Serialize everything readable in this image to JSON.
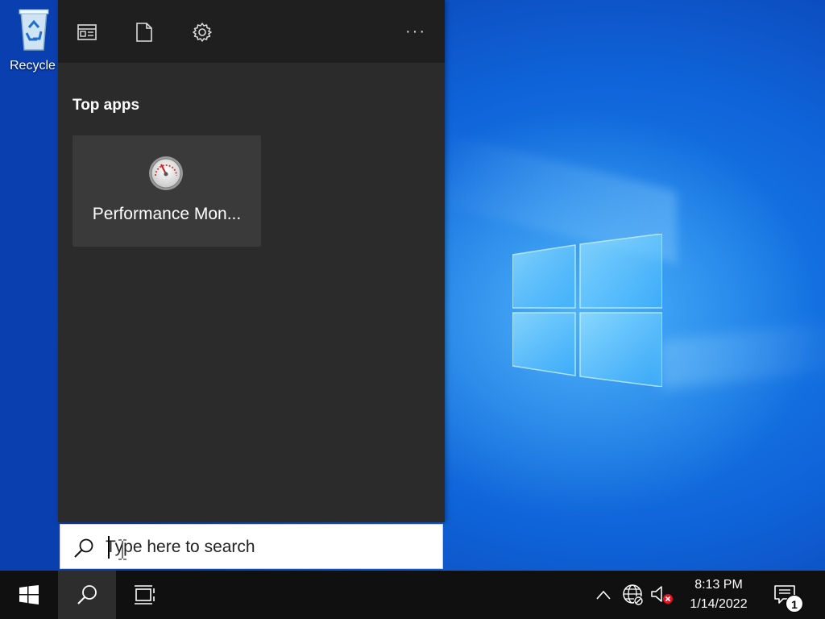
{
  "desktop": {
    "recycle_bin_label": "Recycle"
  },
  "search_panel": {
    "header_icons": [
      "app-tile-icon",
      "document-icon",
      "gear-icon"
    ],
    "more_label": "···",
    "top_apps_title": "Top apps",
    "top_apps": [
      {
        "name": "Performance Mon...",
        "icon": "performance-monitor-icon"
      }
    ]
  },
  "search_box": {
    "placeholder": "Type here to search",
    "value": ""
  },
  "taskbar": {
    "buttons": [
      "start-icon",
      "search-icon",
      "task-view-icon"
    ],
    "tray_icons": [
      "chevron-up-icon",
      "network-icon",
      "volume-muted-icon"
    ],
    "time": "8:13 PM",
    "date": "1/14/2022",
    "notification_count": "1"
  },
  "colors": {
    "panel_bg": "#2b2b2b",
    "panel_header_bg": "#1f1f1f",
    "tile_bg": "#3a3a3a",
    "taskbar_bg": "#101010",
    "wallpaper_blue": "#0f63d8"
  }
}
